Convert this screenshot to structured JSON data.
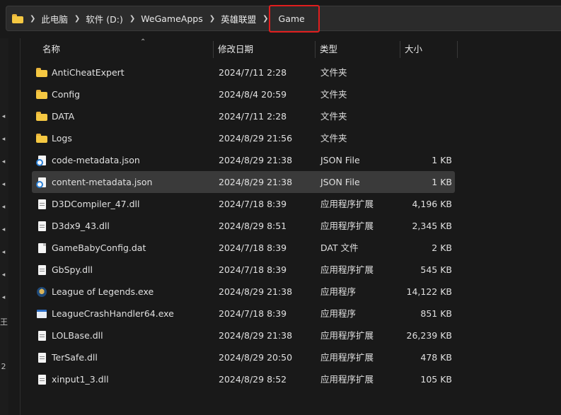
{
  "breadcrumb": [
    "此电脑",
    "软件 (D:)",
    "WeGameApps",
    "英雄联盟",
    "Game"
  ],
  "columns": {
    "name": "名称",
    "date": "修改日期",
    "type": "类型",
    "size": "大小"
  },
  "left_pane": {
    "glyph_1": "王",
    "glyph_2": "2"
  },
  "files": [
    {
      "name": "AntiCheatExpert",
      "date": "2024/7/11 2:28",
      "type": "文件夹",
      "size": "",
      "icon": "folder-icon"
    },
    {
      "name": "Config",
      "date": "2024/8/4 20:59",
      "type": "文件夹",
      "size": "",
      "icon": "folder-icon"
    },
    {
      "name": "DATA",
      "date": "2024/7/11 2:28",
      "type": "文件夹",
      "size": "",
      "icon": "folder-icon"
    },
    {
      "name": "Logs",
      "date": "2024/8/29 21:56",
      "type": "文件夹",
      "size": "",
      "icon": "folder-icon"
    },
    {
      "name": "code-metadata.json",
      "date": "2024/8/29 21:38",
      "type": "JSON File",
      "size": "1 KB",
      "icon": "json-file-icon"
    },
    {
      "name": "content-metadata.json",
      "date": "2024/8/29 21:38",
      "type": "JSON File",
      "size": "1 KB",
      "icon": "json-file-icon",
      "selected": true
    },
    {
      "name": "D3DCompiler_47.dll",
      "date": "2024/7/18 8:39",
      "type": "应用程序扩展",
      "size": "4,196 KB",
      "icon": "dll-file-icon"
    },
    {
      "name": "D3dx9_43.dll",
      "date": "2024/8/29 8:51",
      "type": "应用程序扩展",
      "size": "2,345 KB",
      "icon": "dll-file-icon"
    },
    {
      "name": "GameBabyConfig.dat",
      "date": "2024/7/18 8:39",
      "type": "DAT 文件",
      "size": "2 KB",
      "icon": "file-icon"
    },
    {
      "name": "GbSpy.dll",
      "date": "2024/7/18 8:39",
      "type": "应用程序扩展",
      "size": "545 KB",
      "icon": "dll-file-icon"
    },
    {
      "name": "League of Legends.exe",
      "date": "2024/8/29 21:38",
      "type": "应用程序",
      "size": "14,122 KB",
      "icon": "league-app-icon"
    },
    {
      "name": "LeagueCrashHandler64.exe",
      "date": "2024/7/18 8:39",
      "type": "应用程序",
      "size": "851 KB",
      "icon": "exe-window-icon"
    },
    {
      "name": "LOLBase.dll",
      "date": "2024/8/29 21:38",
      "type": "应用程序扩展",
      "size": "26,239 KB",
      "icon": "dll-file-icon"
    },
    {
      "name": "TerSafe.dll",
      "date": "2024/8/29 20:50",
      "type": "应用程序扩展",
      "size": "478 KB",
      "icon": "dll-file-icon"
    },
    {
      "name": "xinput1_3.dll",
      "date": "2024/8/29 8:52",
      "type": "应用程序扩展",
      "size": "105 KB",
      "icon": "dll-file-icon"
    }
  ],
  "colors": {
    "highlight_box": "#e01e1e",
    "folder": "#f5c842",
    "selected_row": "#3a3a3a"
  }
}
